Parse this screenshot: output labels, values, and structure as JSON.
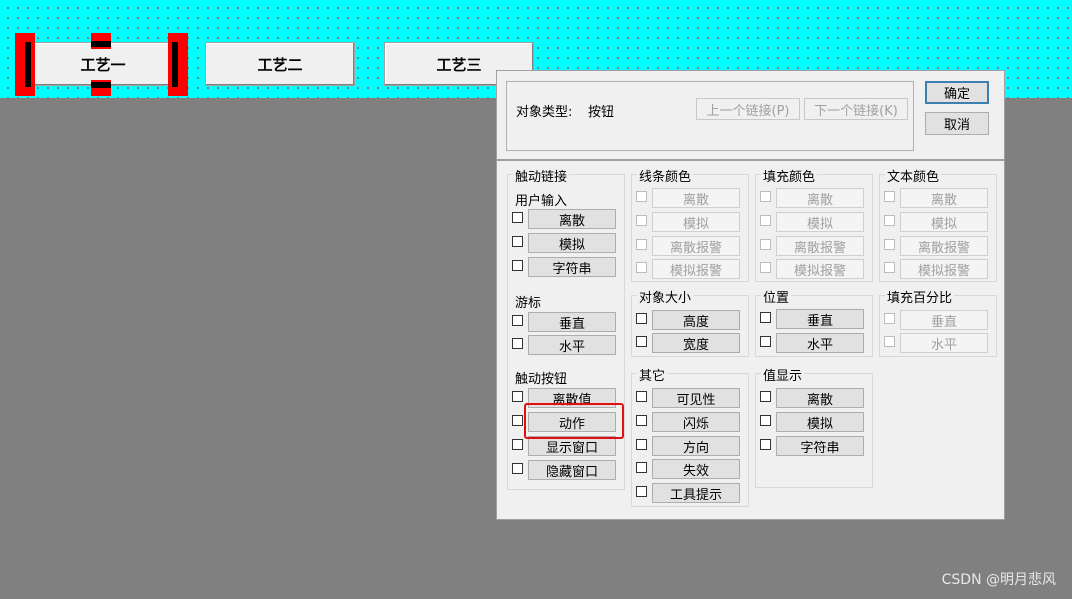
{
  "canvas": {
    "buttons": [
      "工艺一",
      "工艺二",
      "工艺三"
    ]
  },
  "dialog": {
    "object_type_label": "对象类型:",
    "object_type_value": "按钮",
    "prev_link": "上一个链接(P)",
    "next_link": "下一个链接(K)",
    "ok": "确定",
    "cancel": "取消",
    "groups": {
      "touch_link": {
        "title": "触动链接",
        "user_input": {
          "title": "用户输入",
          "items": [
            "离散",
            "模拟",
            "字符串"
          ]
        },
        "cursor": {
          "title": "游标",
          "items": [
            "垂直",
            "水平"
          ]
        },
        "touch_button": {
          "title": "触动按钮",
          "items": [
            "离散值",
            "动作",
            "显示窗口",
            "隐藏窗口"
          ]
        }
      },
      "line_color": {
        "title": "线条颜色",
        "items": [
          "离散",
          "模拟",
          "离散报警",
          "模拟报警"
        ],
        "disabled": true
      },
      "fill_color": {
        "title": "填充颜色",
        "items": [
          "离散",
          "模拟",
          "离散报警",
          "模拟报警"
        ],
        "disabled": true
      },
      "text_color": {
        "title": "文本颜色",
        "items": [
          "离散",
          "模拟",
          "离散报警",
          "模拟报警"
        ],
        "disabled": true
      },
      "object_size": {
        "title": "对象大小",
        "items": [
          "高度",
          "宽度"
        ]
      },
      "position": {
        "title": "位置",
        "items": [
          "垂直",
          "水平"
        ]
      },
      "fill_percent": {
        "title": "填充百分比",
        "items": [
          "垂直",
          "水平"
        ],
        "disabled": true
      },
      "other": {
        "title": "其它",
        "items": [
          "可见性",
          "闪烁",
          "方向",
          "失效",
          "工具提示"
        ]
      },
      "value_display": {
        "title": "值显示",
        "items": [
          "离散",
          "模拟",
          "字符串"
        ]
      }
    }
  },
  "watermark": "CSDN @明月悲风",
  "colors": {
    "canvas": "#00ffff",
    "workspace": "#808080",
    "selection": "#ff0000",
    "highlight": "#e01010"
  }
}
